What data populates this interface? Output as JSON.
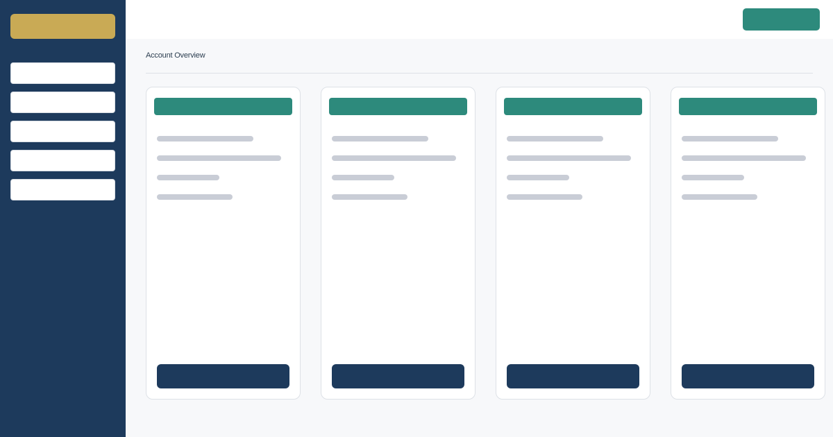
{
  "header": {
    "action_label": ""
  },
  "main": {
    "page_title": "Account Overview"
  },
  "colors": {
    "sidebar_bg": "#1d3a5c",
    "brand_gold": "#c9aa55",
    "accent_teal": "#2d8a7c",
    "button_navy": "#1d3a5c",
    "placeholder_gray": "#c9cdd6"
  }
}
